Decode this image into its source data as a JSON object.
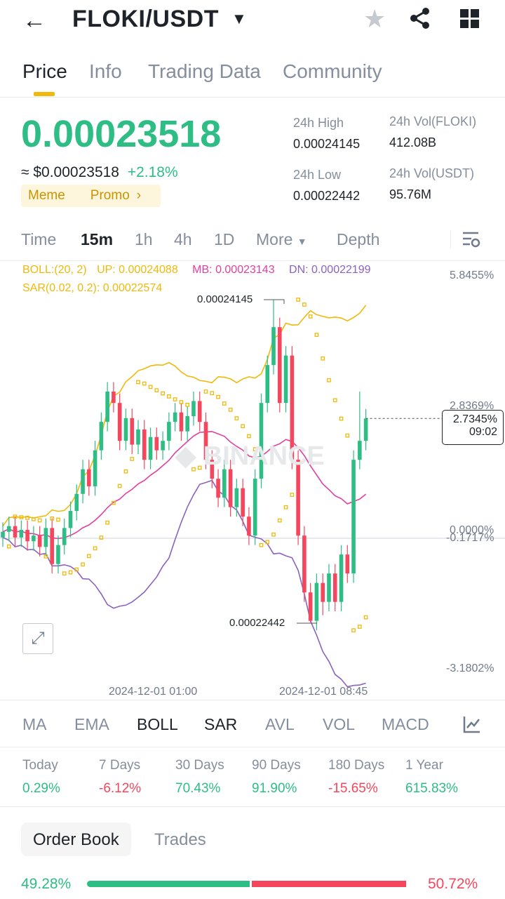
{
  "header": {
    "title": "FLOKI/USDT"
  },
  "tabs": [
    {
      "label": "Price"
    },
    {
      "label": "Info"
    },
    {
      "label": "Trading Data"
    },
    {
      "label": "Community"
    }
  ],
  "ticker": {
    "last_price": "0.00023518",
    "usd_price": "≈ $0.00023518",
    "change": "+2.18%",
    "tags": [
      "Meme",
      "Promo"
    ],
    "high_label": "24h High",
    "high": "0.00024145",
    "low_label": "24h Low",
    "low": "0.00022442",
    "vol_base_label": "24h Vol(FLOKI)",
    "vol_base": "412.08B",
    "vol_quote_label": "24h Vol(USDT)",
    "vol_quote": "95.76M"
  },
  "timeframes": [
    {
      "label": "Time"
    },
    {
      "label": "15m"
    },
    {
      "label": "1h"
    },
    {
      "label": "4h"
    },
    {
      "label": "1D"
    },
    {
      "label": "More"
    },
    {
      "label": "Depth"
    }
  ],
  "indicators_legend": {
    "boll": "BOLL:(20, 2)",
    "up": "UP: 0.00024088",
    "mb": "MB: 0.00023143",
    "dn": "DN: 0.00022199",
    "sar": "SAR(0.02, 0.2): 0.00022574"
  },
  "colors": {
    "green": "#2ebd85",
    "red": "#f6465d",
    "boll_up": "#f0b90b",
    "boll_mb": "#e040a0",
    "boll_dn": "#8c62c0",
    "sar": "#f0b90b"
  },
  "chart_data": {
    "type": "candlestick",
    "y_axis_labels": [
      "5.8455%",
      "2.8369%",
      "0.0000%",
      "-0.1717%",
      "-3.1802%"
    ],
    "x_labels": [
      "2024-12-01 01:00",
      "2024-12-01 08:45"
    ],
    "high_marker": "0.00024145",
    "low_marker": "0.00022442",
    "current": {
      "pct": "2.7345%",
      "countdown": "09:02"
    },
    "unit": "1e-6 USDT",
    "closes": [
      229.2,
      229.5,
      228.9,
      229.3,
      228.7,
      229.0,
      228.4,
      229.4,
      227.5,
      228.5,
      229.4,
      230.3,
      231.2,
      232.5,
      231.6,
      233.5,
      235.0,
      236.6,
      236.0,
      234.0,
      235.2,
      233.8,
      234.6,
      233.0,
      234.2,
      233.5,
      234.0,
      235.0,
      235.5,
      234.5,
      235.3,
      236.1,
      235.0,
      233.0,
      232.0,
      231.0,
      232.5,
      230.5,
      231.5,
      230.0,
      229.0,
      232.0,
      236.0,
      238.0,
      240.0,
      236.0,
      238.5,
      233.0,
      229.0,
      226.0,
      224.5,
      226.5,
      225.5,
      227.0,
      225.5,
      228.0,
      227.0,
      233.0,
      234.0,
      235.18
    ]
  },
  "indicator_tabs": [
    {
      "label": "MA"
    },
    {
      "label": "EMA"
    },
    {
      "label": "BOLL"
    },
    {
      "label": "SAR"
    },
    {
      "label": "AVL"
    },
    {
      "label": "VOL"
    },
    {
      "label": "MACD"
    }
  ],
  "performance": [
    {
      "label": "Today",
      "value": "0.29%"
    },
    {
      "label": "7 Days",
      "value": "-6.12%"
    },
    {
      "label": "30 Days",
      "value": "70.43%"
    },
    {
      "label": "90 Days",
      "value": "91.90%"
    },
    {
      "label": "180 Days",
      "value": "-15.65%"
    },
    {
      "label": "1 Year",
      "value": "615.83%"
    }
  ],
  "orderbook": {
    "tabs": [
      {
        "label": "Order Book"
      },
      {
        "label": "Trades"
      }
    ],
    "buy_pct": "49.28%",
    "sell_pct": "50.72%",
    "buy_ratio": 49.28
  }
}
